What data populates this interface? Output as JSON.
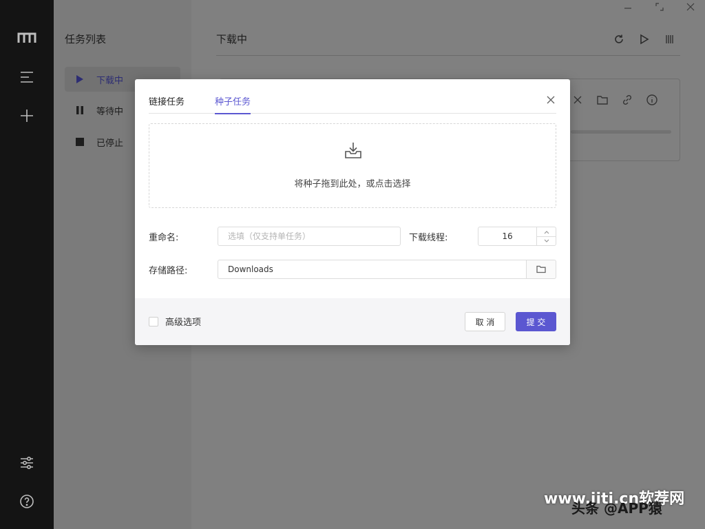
{
  "colors": {
    "accent": "#5b57d1",
    "rail": "#141414"
  },
  "rail": {
    "icons": [
      "logo-icon",
      "menu-icon",
      "add-icon",
      "settings-sliders-icon",
      "help-icon"
    ]
  },
  "sidebar": {
    "title": "任务列表",
    "items": [
      {
        "label": "下载中",
        "icon": "play-icon",
        "active": true
      },
      {
        "label": "等待中",
        "icon": "pause-icon",
        "active": false
      },
      {
        "label": "已停止",
        "icon": "stop-icon",
        "active": false
      }
    ]
  },
  "main": {
    "heading": "下载中",
    "actions": [
      "refresh-icon",
      "play-icon",
      "pause-icon"
    ],
    "card_icons": [
      "close-icon",
      "folder-icon",
      "link-icon",
      "info-icon"
    ]
  },
  "dialog": {
    "tabs": [
      {
        "label": "链接任务",
        "active": false
      },
      {
        "label": "种子任务",
        "active": true
      }
    ],
    "dropzone_text": "将种子拖到此处，或点击选择",
    "rename_label": "重命名:",
    "rename_placeholder": "选填（仅支持单任务）",
    "threads_label": "下载线程:",
    "threads_value": "16",
    "path_label": "存储路径:",
    "path_value": "Downloads",
    "advanced_label": "高级选项",
    "cancel_label": "取 消",
    "submit_label": "提 交"
  },
  "watermark": {
    "line1": "www.jiti.cn软荐网",
    "line2": "头条 @APP猿"
  }
}
